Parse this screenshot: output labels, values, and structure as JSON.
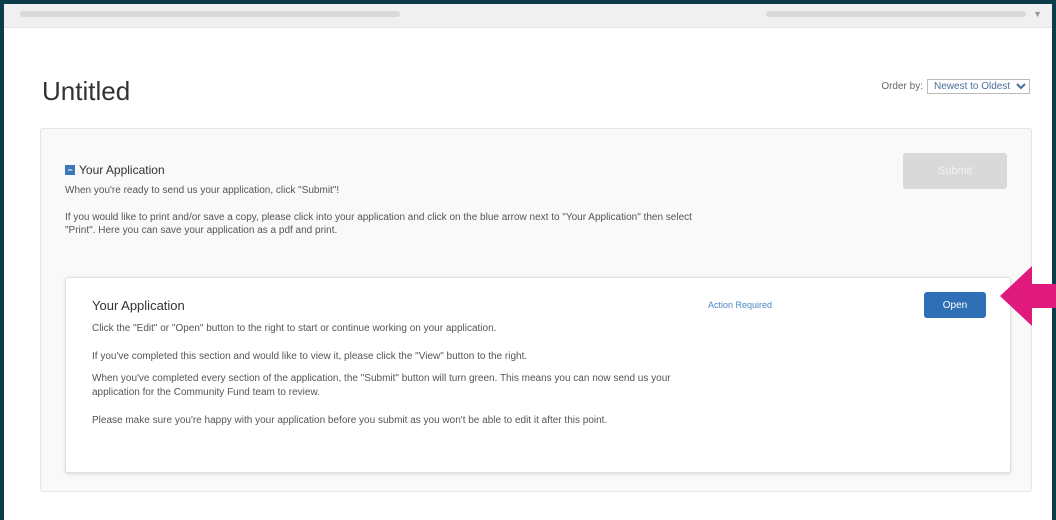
{
  "page": {
    "title": "Untitled"
  },
  "order_by": {
    "label": "Order by:",
    "selected": "Newest to Oldest"
  },
  "section": {
    "heading": "Your Application",
    "toggle_symbol": "−",
    "description_1": "When you're ready to send us your application, click \"Submit\"!",
    "description_2": "If you would like to print and/or save a copy, please click into your application and click on the blue arrow next to \"Your Application\" then select \"Print\". Here you can save your application as a pdf and print.",
    "submit_label": "Submit"
  },
  "task": {
    "title": "Your Application",
    "status": "Action Required",
    "open_label": "Open",
    "instructions": [
      "Click the \"Edit\" or \"Open\" button to the right to start or continue working on your application.",
      "If you've completed this section and would like to view it, please click the \"View\" button to the right.",
      "When you've completed every section of the application, the \"Submit\" button will turn green. This means you can now send us your application for the Community Fund team to review.",
      "Please make sure you're happy with your application before you submit as you won't be able to edit it after this point."
    ]
  },
  "colors": {
    "frame_border": "#0c3b4a",
    "primary_button": "#2f6fb5",
    "disabled_button": "#d9d9d9",
    "link": "#4a86c5",
    "annotation_arrow": "#e0197d"
  },
  "icons": {
    "annotation": "arrow-left-icon",
    "dropdown": "chevron-down-icon"
  }
}
